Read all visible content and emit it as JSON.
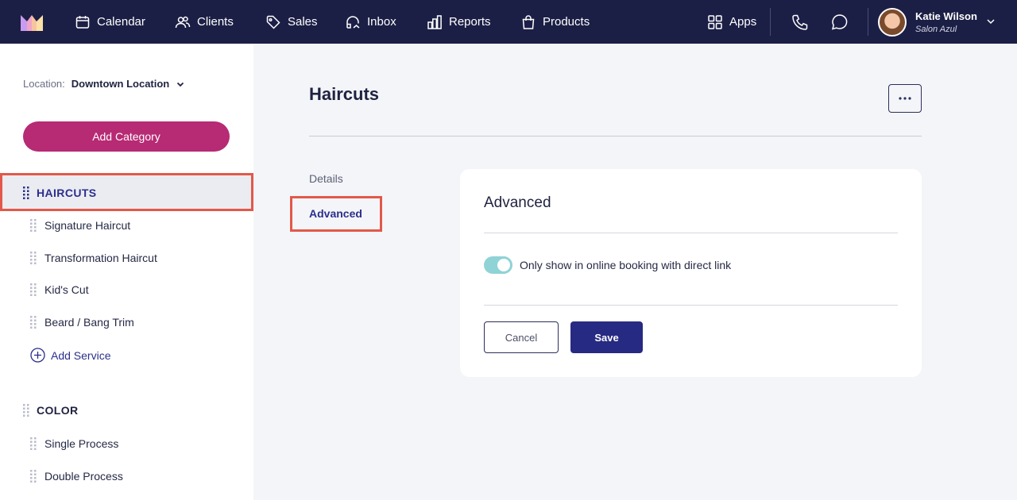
{
  "topnav": {
    "items": [
      {
        "label": "Calendar",
        "icon": "calendar-icon"
      },
      {
        "label": "Clients",
        "icon": "clients-icon"
      },
      {
        "label": "Sales",
        "icon": "tag-icon"
      },
      {
        "label": "Inbox",
        "icon": "inbox-icon"
      },
      {
        "label": "Reports",
        "icon": "bar-chart-icon"
      },
      {
        "label": "Products",
        "icon": "shopping-bag-icon"
      }
    ],
    "apps_label": "Apps",
    "user": {
      "name": "Katie Wilson",
      "salon": "Salon Azul"
    }
  },
  "sidebar": {
    "location_label": "Location:",
    "location_value": "Downtown Location",
    "add_category_label": "Add Category",
    "categories": [
      {
        "label": "HAIRCUTS",
        "selected": true,
        "services": [
          "Signature Haircut",
          "Transformation Haircut",
          "Kid's Cut",
          "Beard / Bang Trim"
        ],
        "add_service_label": "Add Service"
      },
      {
        "label": "COLOR",
        "selected": false,
        "services": [
          "Single Process",
          "Double Process"
        ]
      }
    ]
  },
  "main": {
    "title": "Haircuts",
    "tabs": [
      {
        "label": "Details",
        "active": false
      },
      {
        "label": "Advanced",
        "active": true
      }
    ],
    "card": {
      "title": "Advanced",
      "toggle_label": "Only show in online booking with direct link",
      "toggle_on": true,
      "cancel_label": "Cancel",
      "save_label": "Save"
    }
  },
  "colors": {
    "nav_bg": "#1c1f45",
    "accent_magenta": "#b72a74",
    "primary_navy": "#272a82",
    "toggle_teal": "#8fd3d6",
    "highlight_red": "#e2584a"
  }
}
